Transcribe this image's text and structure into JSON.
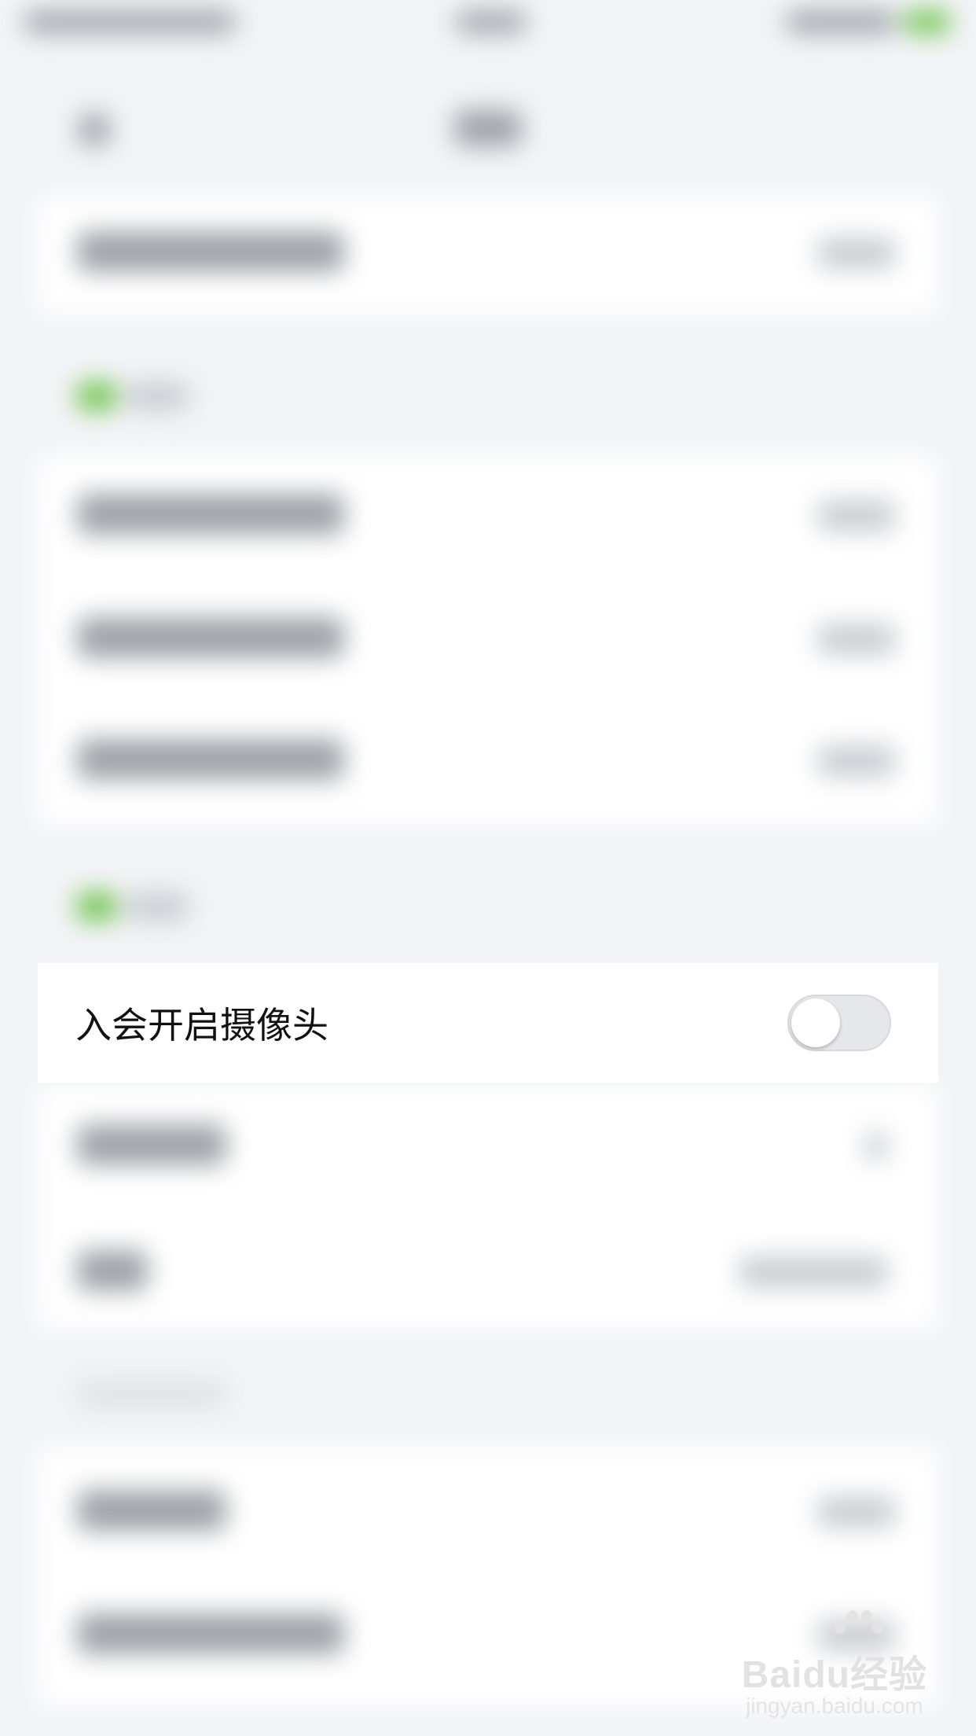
{
  "setting": {
    "label": "入会开启摄像头",
    "enabled": false
  },
  "colors": {
    "accent": "#6cc24a",
    "toggle_off_track": "#e6e7eb",
    "background": "#f3f4f7"
  },
  "watermark": {
    "logo_text": "Baidu经验",
    "url_text": "jingyan.baidu.com"
  }
}
